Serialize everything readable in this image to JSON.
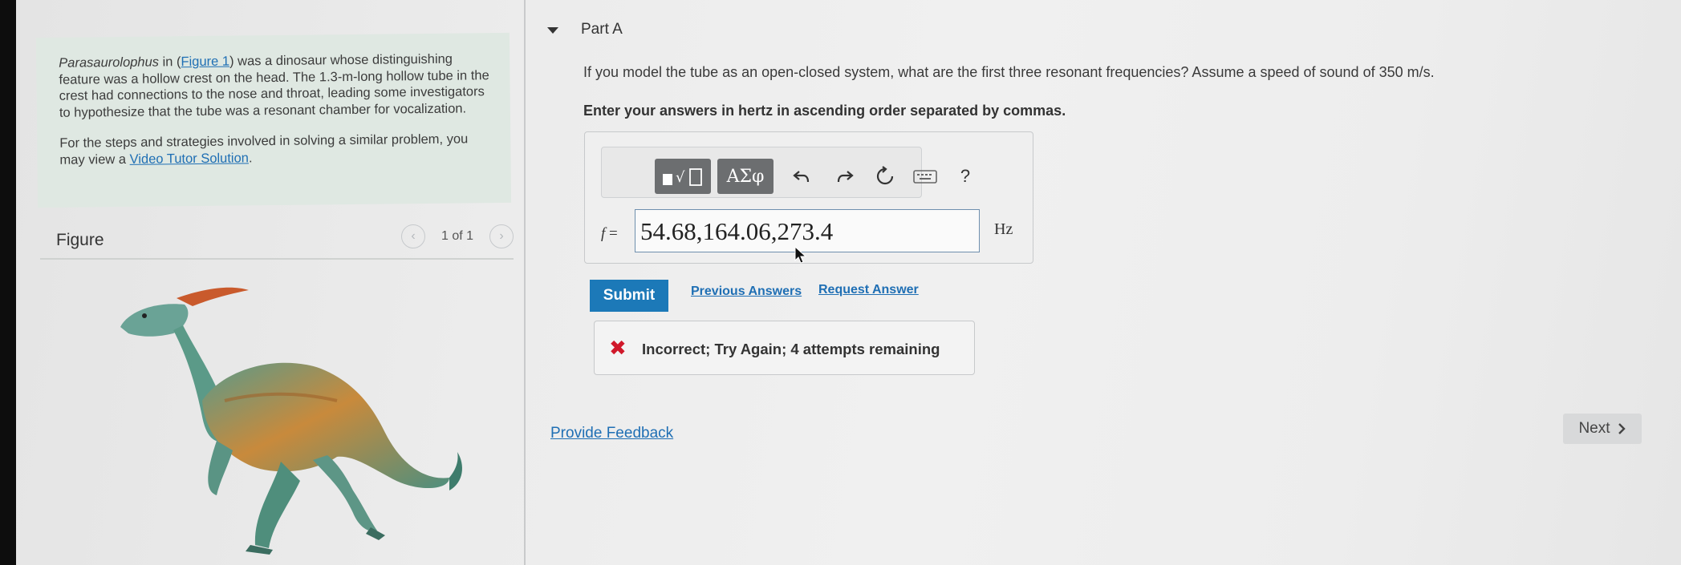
{
  "left_panel": {
    "intro_paragraph_1": {
      "term": "Parasaurolophus",
      "pre_link": " in (",
      "link": "Figure 1",
      "post_link": ") was a dinosaur whose distinguishing feature was a hollow crest on the head. The 1.3-m-long hollow tube in the crest had connections to the nose and throat, leading some investigators to hypothesize that the tube was a resonant chamber for vocalization."
    },
    "intro_paragraph_2": {
      "text": "For the steps and strategies involved in solving a similar problem, you may view a ",
      "link": "Video Tutor Solution",
      "end": "."
    },
    "figure": {
      "title": "Figure",
      "pager_text": "1 of 1",
      "prev_icon": "chevron-left-icon",
      "next_icon": "chevron-right-icon",
      "image": "parasaurolophus-illustration"
    }
  },
  "part": {
    "title": "Part A",
    "question": "If you model the tube as an open-closed system, what are the first three resonant frequencies? Assume a speed of sound of 350 m/s.",
    "instructions": "Enter your answers in hertz in ascending order separated by commas."
  },
  "answer": {
    "toolbar": {
      "template_icon": "templates-icon",
      "greek_label": "ΑΣφ",
      "undo_icon": "undo-icon",
      "redo_icon": "redo-icon",
      "reset_icon": "reset-icon",
      "keyboard_icon": "keyboard-icon",
      "help_label": "?"
    },
    "variable": "f",
    "equals": " =",
    "value": "54.68,164.06,273.4",
    "unit": "Hz"
  },
  "actions": {
    "submit": "Submit",
    "previous_answers": "Previous Answers",
    "request_answer": "Request Answer"
  },
  "feedback": {
    "icon": "x-icon",
    "message": "Incorrect; Try Again; 4 attempts remaining"
  },
  "footer": {
    "provide_feedback": "Provide Feedback",
    "next": "Next"
  }
}
